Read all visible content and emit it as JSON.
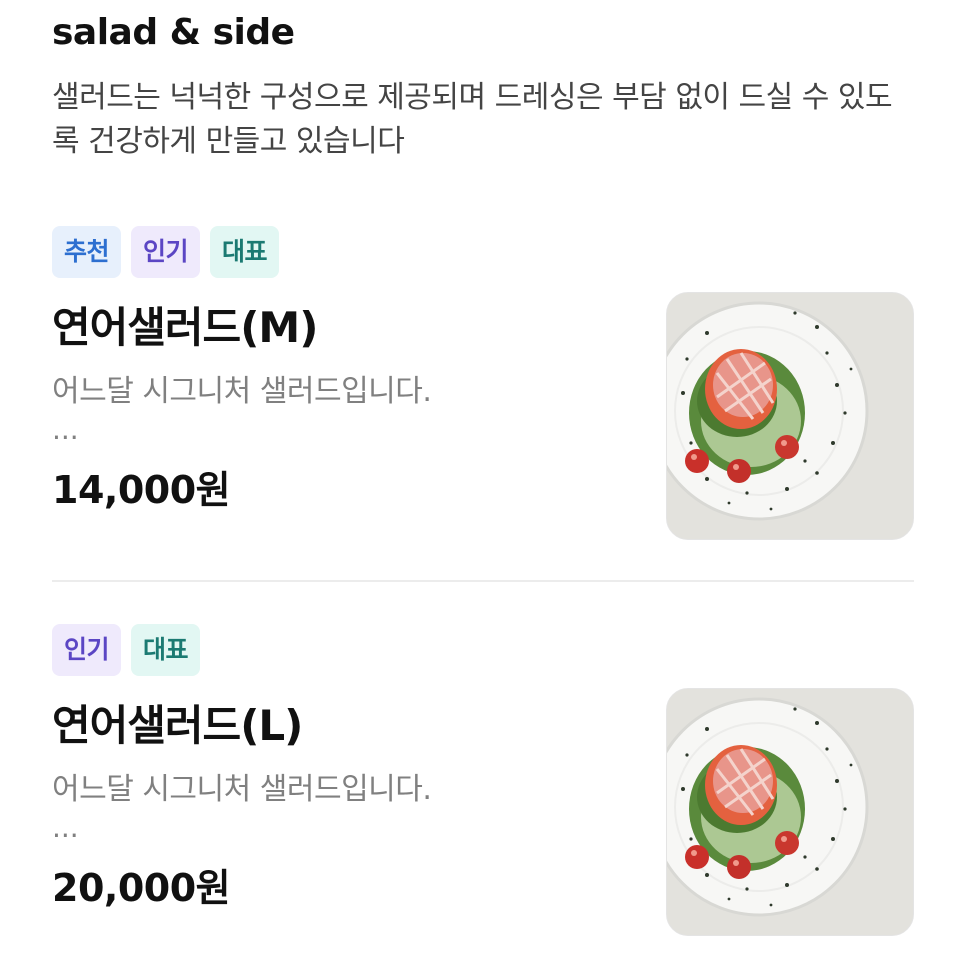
{
  "section": {
    "title": "salad & side",
    "description": "샐러드는 넉넉한 구성으로 제공되며 드레싱은 부담 없이 드실 수 있도록 건강하게 만들고 있습니다"
  },
  "items": [
    {
      "badges": [
        "추천",
        "인기",
        "대표"
      ],
      "name": "연어샐러드(M)",
      "description": "어느달 시그니처 샐러드입니다.",
      "more": "...",
      "price": "14,000원"
    },
    {
      "badges": [
        "인기",
        "대표"
      ],
      "name": "연어샐러드(L)",
      "description": "어느달 시그니처 샐러드입니다.",
      "more": "...",
      "price": "20,000원"
    }
  ],
  "colors": {
    "badge_recommend_bg": "#e7f0fc",
    "badge_recommend_text": "#2d6fd0",
    "badge_popular_bg": "#efeafc",
    "badge_popular_text": "#5b46c4",
    "badge_signature_bg": "#e2f7f3",
    "badge_signature_text": "#1b7a72"
  }
}
